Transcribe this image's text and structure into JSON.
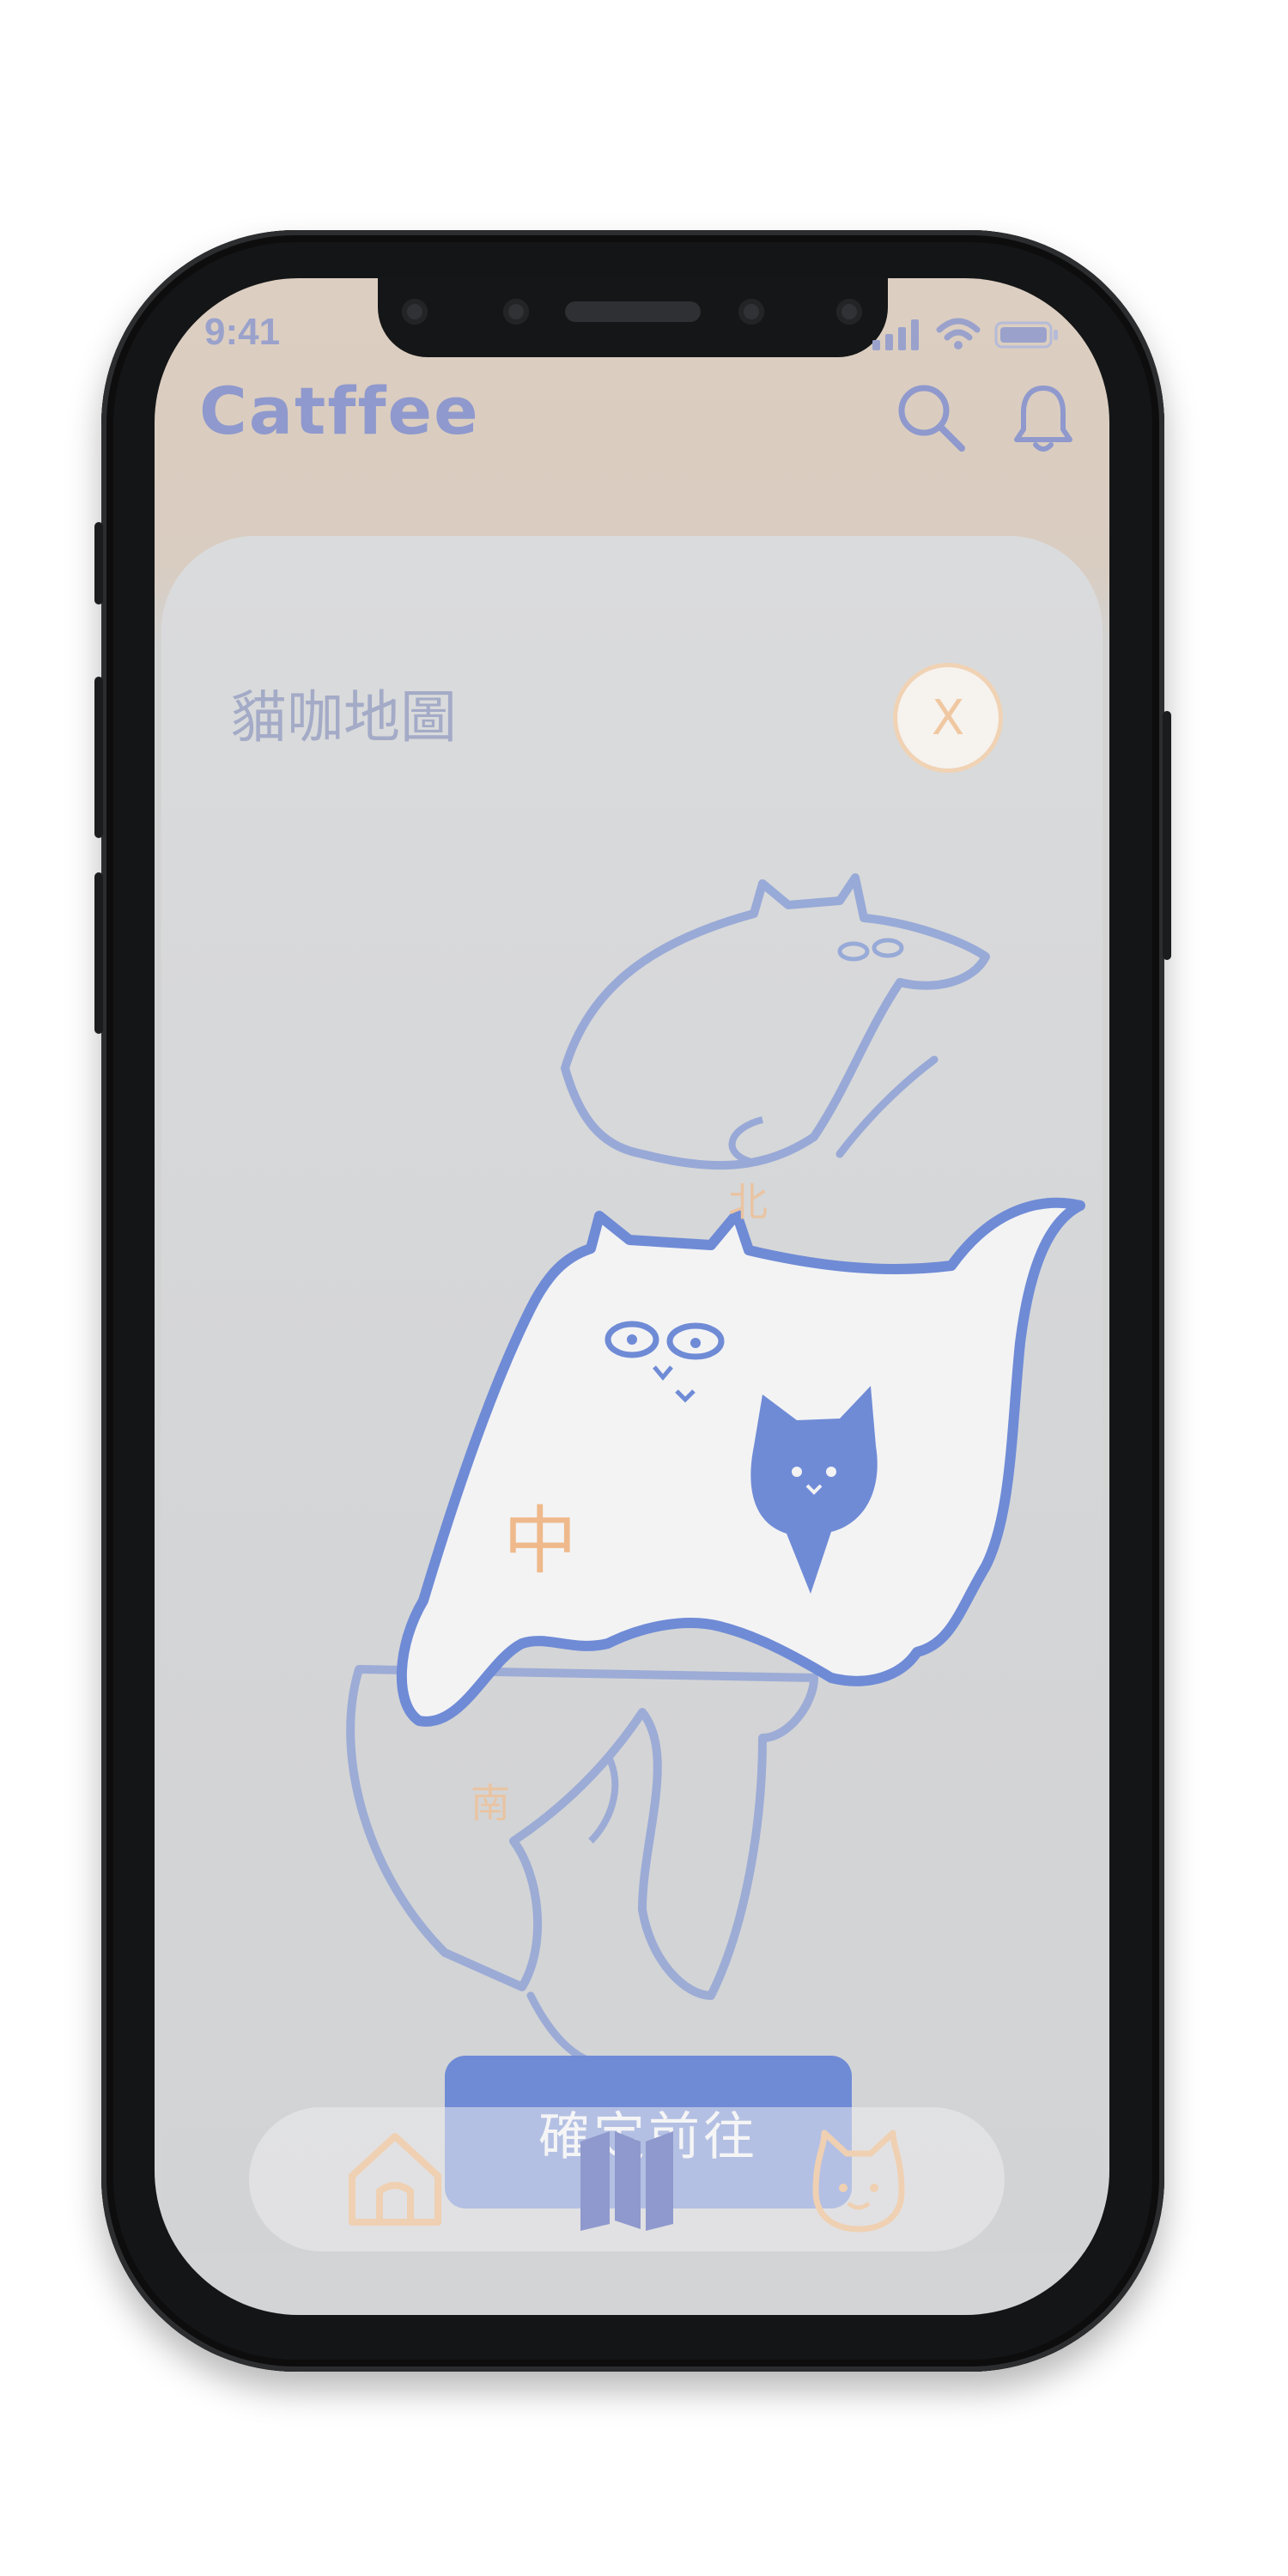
{
  "status_bar": {
    "time": "9:41"
  },
  "app": {
    "title": "Catffee"
  },
  "sheet": {
    "title": "貓咖地圖",
    "close_label": "X",
    "regions": {
      "north": "北",
      "central": "中",
      "south": "南"
    },
    "confirm_label": "確定前往"
  },
  "icons": {
    "search": "search-icon",
    "bell": "bell-icon",
    "home": "home-icon",
    "map": "map-icon",
    "cat": "cat-icon"
  },
  "colors": {
    "brand": "#8f99cd",
    "accent_blue": "#6f8bd6",
    "accent_peach": "#efc8a2",
    "header_bg": "#dccec1"
  }
}
